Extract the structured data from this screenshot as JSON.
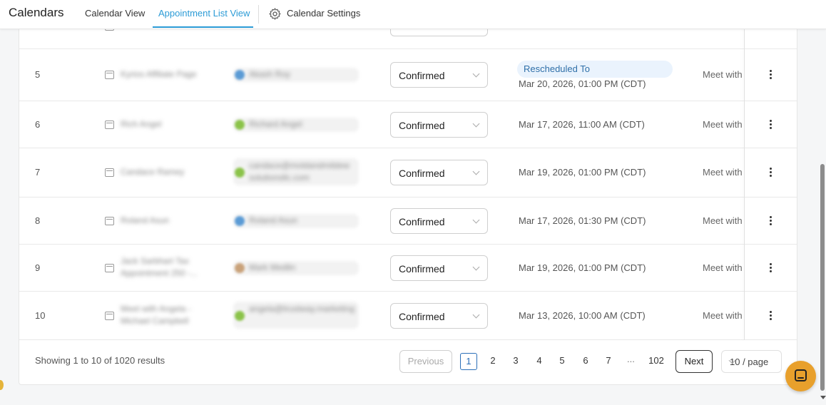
{
  "header": {
    "title": "Calendars",
    "tabs": [
      {
        "label": "Calendar View"
      },
      {
        "label": "Appointment List View"
      },
      {
        "label": "Calendar Settings"
      }
    ]
  },
  "rows": [
    {
      "num": "5",
      "calendar": "Kyrios Affiliate Page",
      "person": "Akash Roy",
      "status": "Confirmed",
      "badge": "Rescheduled To",
      "date": "Mar 20, 2026, 01:00 PM (CDT)",
      "meet": "Meet with"
    },
    {
      "num": "6",
      "calendar": "Rich Angel",
      "person": "Richard Angel",
      "status": "Confirmed",
      "date": "Mar 17, 2026, 11:00 AM (CDT)",
      "meet": "Meet with"
    },
    {
      "num": "7",
      "calendar": "Candace Ramey",
      "person": "candace@moldandmildew solutionsllc.com",
      "status": "Confirmed",
      "date": "Mar 19, 2026, 01:00 PM (CDT)",
      "meet": "Meet with"
    },
    {
      "num": "8",
      "calendar": "Roland Asun",
      "person": "Roland Asun",
      "status": "Confirmed",
      "date": "Mar 17, 2026, 01:30 PM (CDT)",
      "meet": "Meet with"
    },
    {
      "num": "9",
      "calendar": "Jack Sarbhart Tax Appointment 250 -...",
      "person": "Mark Medlin",
      "status": "Confirmed",
      "date": "Mar 19, 2026, 01:00 PM (CDT)",
      "meet": "Meet with"
    },
    {
      "num": "10",
      "calendar": "Meet with Angela - Michael Campbell",
      "person": "angela@trustway.marketing",
      "status": "Confirmed",
      "date": "Mar 13, 2026, 10:00 AM (CDT)",
      "meet": "Meet with"
    }
  ],
  "footer": {
    "showing": "Showing 1 to 10 of 1020 results",
    "previous": "Previous",
    "pages": [
      "1",
      "2",
      "3",
      "4",
      "5",
      "6",
      "7"
    ],
    "ellipsis": "...",
    "last_page": "102",
    "next": "Next",
    "per_page": "10 / page"
  },
  "colors": {
    "accent": "#2b9bd6",
    "chat": "#e8a02c"
  }
}
